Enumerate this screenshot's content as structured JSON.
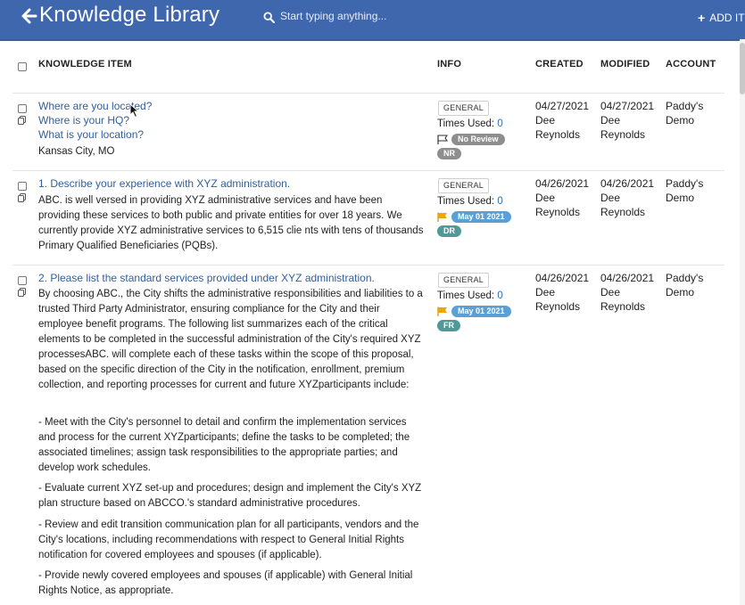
{
  "header": {
    "title": "Knowledge Library",
    "search_placeholder": "Start typing anything...",
    "add_label": "ADD IT"
  },
  "columns": {
    "item": "KNOWLEDGE ITEM",
    "info": "INFO",
    "created": "CREATED",
    "modified": "MODIFIED",
    "account": "ACCOUNT"
  },
  "rows": [
    {
      "questions": [
        "Where are you located?",
        "Where is your HQ?",
        "What is your location?"
      ],
      "answer": "Kansas City, MO",
      "tag": "GENERAL",
      "times_used_label": "Times Used: ",
      "times_used": "0",
      "status": "No Review",
      "initials": "NR",
      "created_date": "04/27/2021",
      "created_by": "Dee Reynolds",
      "modified_date": "04/27/2021",
      "modified_by": "Dee Reynolds",
      "account": "Paddy's Demo"
    },
    {
      "questions": [
        "1. Describe your experience with XYZ administration."
      ],
      "answer": "ABC. is well versed in providing XYZ administrative services and have been providing these services to both public and private entities for over 18 years. We currently provide XYZ administrative services to 6,515 clie nts with tens of thousands Primary Qualified Beneficiaries (PQBs).",
      "tag": "GENERAL",
      "times_used_label": "Times Used: ",
      "times_used": "0",
      "status": "May 01 2021",
      "initials": "DR",
      "created_date": "04/26/2021",
      "created_by": "Dee Reynolds",
      "modified_date": "04/26/2021",
      "modified_by": "Dee Reynolds",
      "account": "Paddy's Demo"
    },
    {
      "questions": [
        "2. Please list the standard services provided under XYZ administration."
      ],
      "answer_paragraphs": [
        "By choosing ABC., the City shifts the administrative responsibilities and liabilities to a trusted Third Party Administrator, ensuring compliance for the City and their employee benefit programs. The following list summarizes each of the critical elements to be completed in the successful administration of the City's required XYZ processesABC. will complete each of these tasks within the scope of this proposal, based on the specific direction of the City in the notification, enrollment, premium collection, and reporting processes for current and future XYZparticipants include:",
        "- Meet with the City's personnel to detail and confirm the implementation services and process for the current XYZparticipants; define the tasks to be completed; the associated timelines; assign task responsibilities to the appropriate parties; and develop work schedules.",
        "- Evaluate current XYZ set-up and procedures; design and implement the City's XYZ plan structure based on ABCCO.'s standard administrative procedures.",
        "- Review and edit transition communication plan for all participants, vendors and the City's locations, including recommendations with respect to General Initial Rights notification for covered employees and spouses (if applicable).",
        "- Provide newly covered employees and spouses (if applicable) with General Initial Rights Notice, as appropriate."
      ],
      "tag": "GENERAL",
      "times_used_label": "Times Used: ",
      "times_used": "0",
      "status": "May 01 2021",
      "initials": "FR",
      "created_date": "04/26/2021",
      "created_by": "Dee Reynolds",
      "modified_date": "04/26/2021",
      "modified_by": "Dee Reynolds",
      "account": "Paddy's Demo"
    }
  ],
  "colors": {
    "header_bg": "#3f67ad",
    "link": "#2f5f9f",
    "flag_orange": "#f0a500",
    "pill_gray": "#8e8e8e",
    "pill_blue": "#5aa0d6",
    "pill_teal": "#4f9a98"
  }
}
